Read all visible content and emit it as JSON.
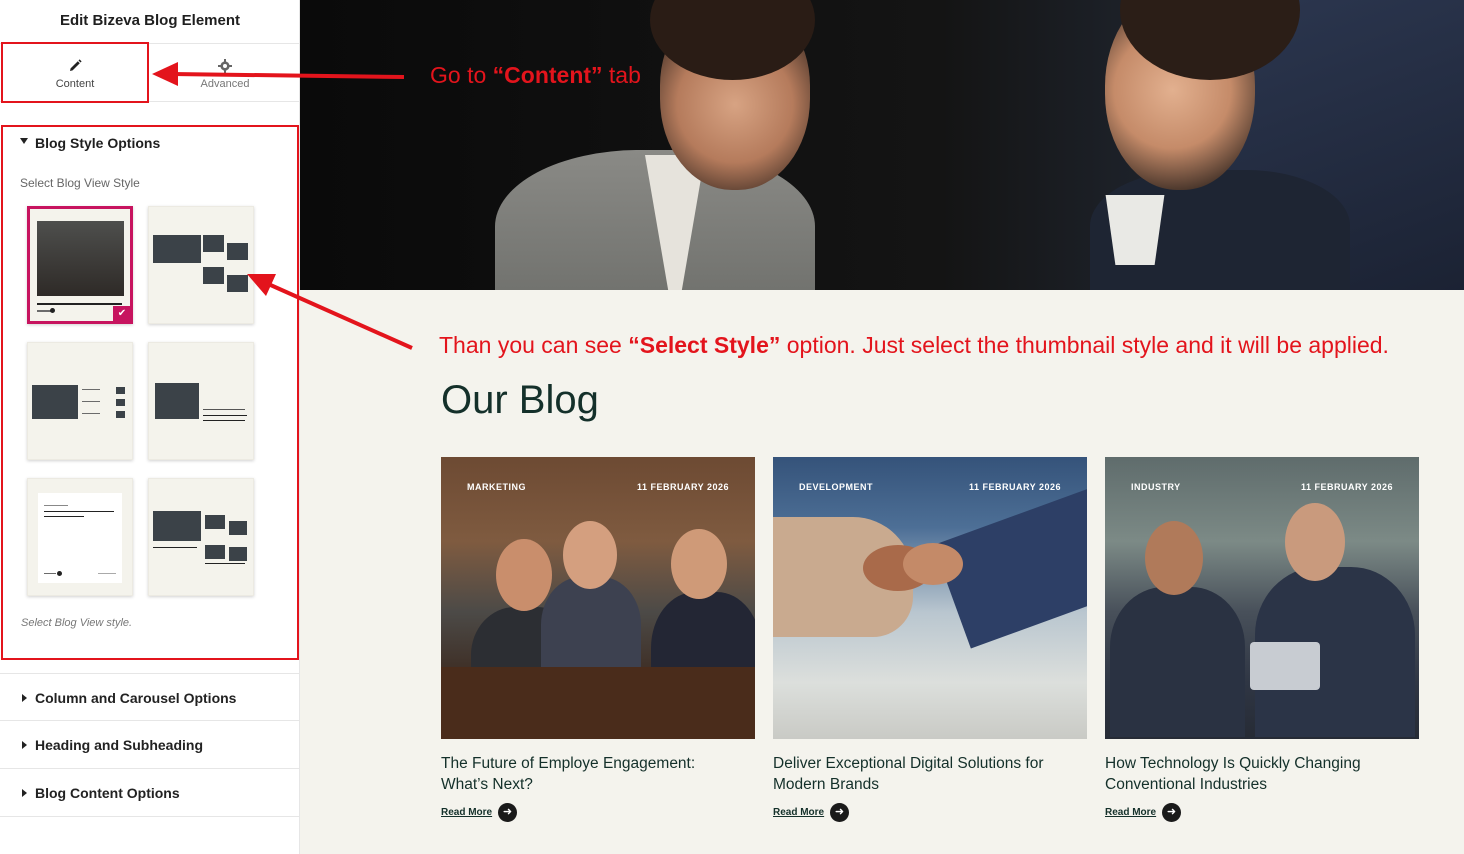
{
  "panel": {
    "title": "Edit Bizeva Blog Element",
    "tabs": [
      {
        "label": "Content",
        "icon": "pencil-icon"
      },
      {
        "label": "Advanced",
        "icon": "gear-icon"
      }
    ],
    "sections": {
      "blog_style": {
        "title": "Blog Style Options",
        "field_label": "Select Blog View Style",
        "help": "Select Blog View style.",
        "selected_index": 0,
        "style_count": 6
      },
      "collapsed": [
        "Column and Carousel Options",
        "Heading and Subheading",
        "Blog Content Options"
      ]
    }
  },
  "annotations": {
    "a1": {
      "pre": "Go  to ",
      "bold": "“Content”",
      "post": " tab"
    },
    "a2": {
      "pre": "Than you can see ",
      "bold": "“Select Style”",
      "post": " option. Just select the thumbnail style and it will be applied."
    },
    "color": "#e3141c"
  },
  "preview": {
    "heading": "Our Blog",
    "cards": [
      {
        "category": "MARKETING",
        "date": "11 FEBRUARY 2026",
        "title": "The Future of Employe Engagement: What’s Next?",
        "read_more": "Read More"
      },
      {
        "category": "DEVELOPMENT",
        "date": "11 FEBRUARY 2026",
        "title": "Deliver Exceptional Digital Solutions for Modern Brands",
        "read_more": "Read More"
      },
      {
        "category": "INDUSTRY",
        "date": "11 FEBRUARY 2026",
        "title": "How Technology Is Quickly Changing Conventional Industries",
        "read_more": "Read More"
      }
    ]
  },
  "colors": {
    "accent": "#c7145f",
    "heading": "#14302a",
    "preview_bg": "#f4f3ed",
    "highlight": "#e3141c"
  }
}
